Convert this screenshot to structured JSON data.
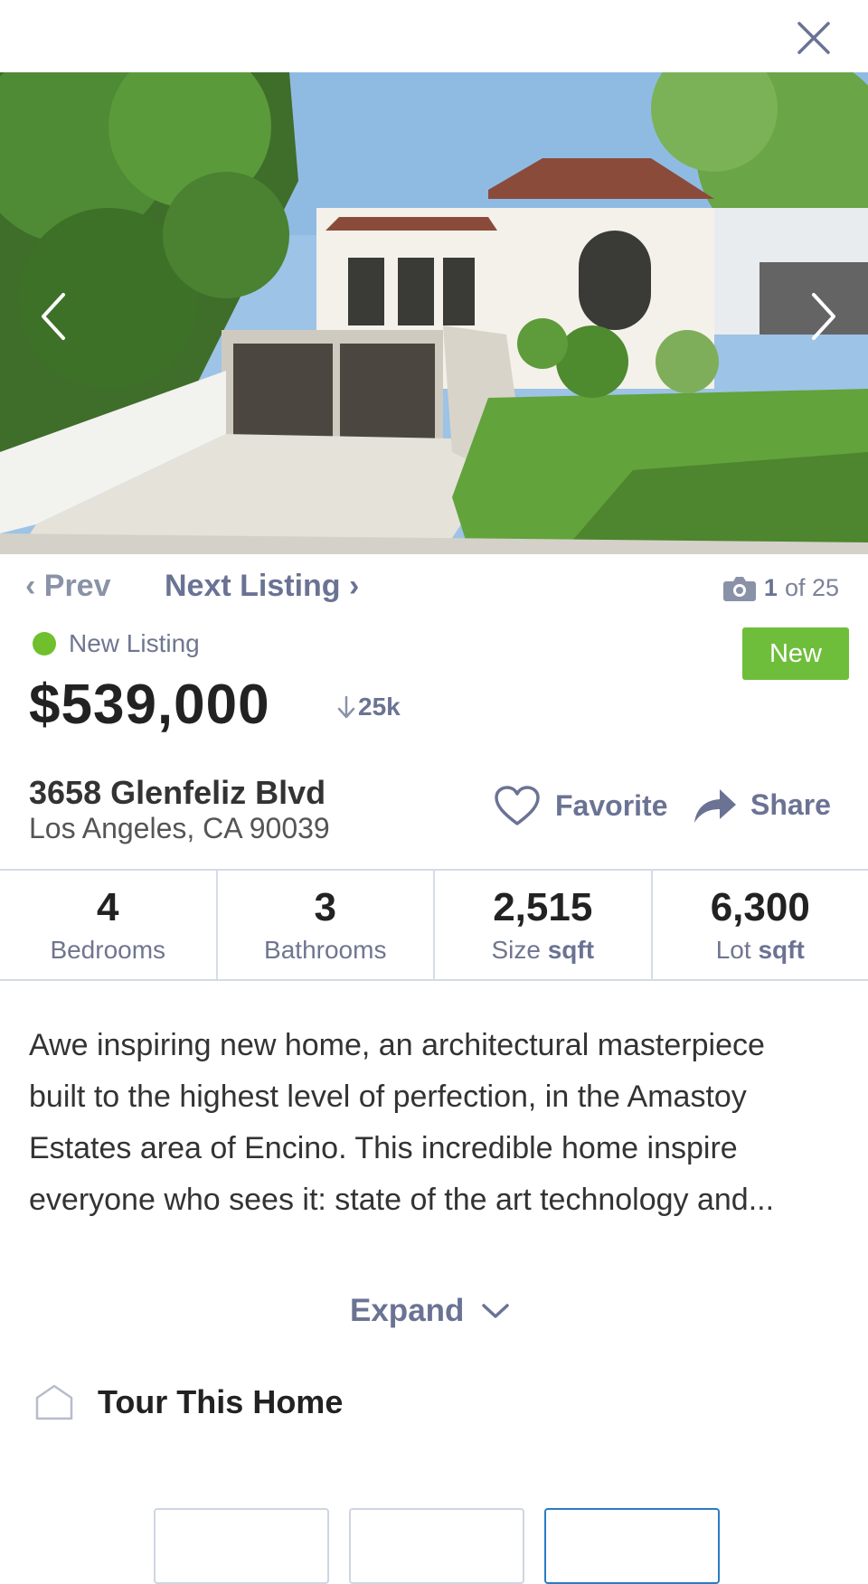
{
  "nav": {
    "prev_label": "‹ Prev",
    "next_label": "Next Listing ›",
    "photo_index": "1",
    "photo_total": "of 25"
  },
  "listing": {
    "status": "New Listing",
    "badge": "New",
    "price": "$539,000",
    "price_drop": "25k",
    "street": "3658 Glenfeliz Blvd",
    "city": "Los Angeles, CA 90039"
  },
  "actions": {
    "favorite": "Favorite",
    "share": "Share"
  },
  "stats": [
    {
      "value": "4",
      "label": "Bedrooms",
      "unit": ""
    },
    {
      "value": "3",
      "label": "Bathrooms",
      "unit": ""
    },
    {
      "value": "2,515",
      "label": "Size",
      "unit": "sqft"
    },
    {
      "value": "6,300",
      "label": "Lot",
      "unit": "sqft"
    }
  ],
  "description": "Awe inspiring new home, an architectural masterpiece built to the highest level of perfection, in the Amastoy Estates area of Encino. This incredible home inspire everyone who sees it: state of the art technology and...",
  "expand_label": "Expand",
  "tour_label": "Tour This Home",
  "colors": {
    "accent": "#6b7394",
    "new_green": "#6fbe3b",
    "selected_blue": "#2b7bc4"
  }
}
